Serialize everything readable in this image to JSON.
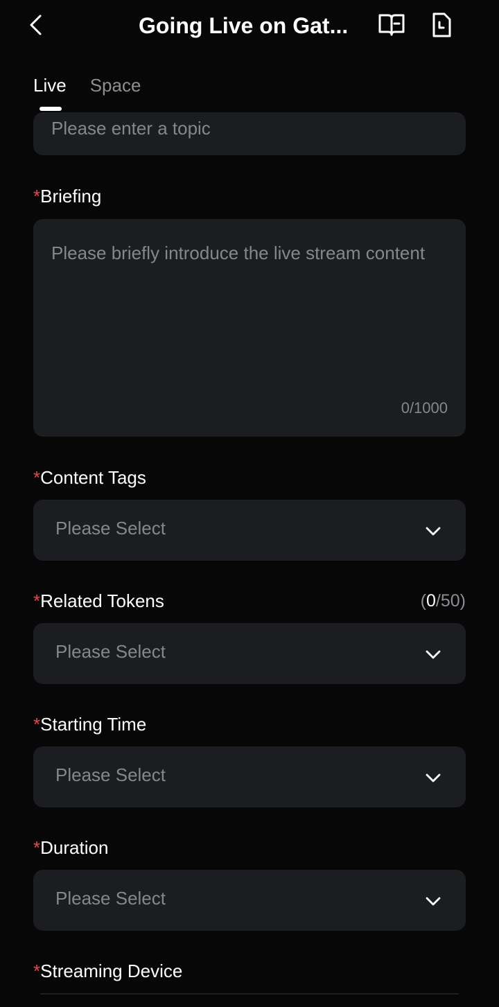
{
  "header": {
    "title": "Going Live on Gat...",
    "back_icon": "chevron-left-icon",
    "guide_icon": "book-icon",
    "history_icon": "document-clock-icon"
  },
  "tabs": [
    {
      "label": "Live",
      "active": true
    },
    {
      "label": "Space",
      "active": false
    }
  ],
  "form": {
    "topic": {
      "placeholder": "Please enter a topic"
    },
    "briefing": {
      "required_mark": "*",
      "label": "Briefing",
      "placeholder": "Please briefly introduce the live stream content",
      "counter": "0/1000"
    },
    "content_tags": {
      "required_mark": "*",
      "label": "Content Tags",
      "placeholder": "Please Select"
    },
    "related_tokens": {
      "required_mark": "*",
      "label": "Related Tokens",
      "placeholder": "Please Select",
      "count_open": "(",
      "count_current": "0",
      "count_rest": "/50)"
    },
    "starting_time": {
      "required_mark": "*",
      "label": "Starting Time",
      "placeholder": "Please Select"
    },
    "duration": {
      "required_mark": "*",
      "label": "Duration",
      "placeholder": "Please Select"
    },
    "streaming_device": {
      "required_mark": "*",
      "label": "Streaming Device"
    }
  },
  "colors": {
    "background": "#070708",
    "field": "#1c1d20",
    "required": "#e5484d",
    "placeholder": "#86878d"
  }
}
